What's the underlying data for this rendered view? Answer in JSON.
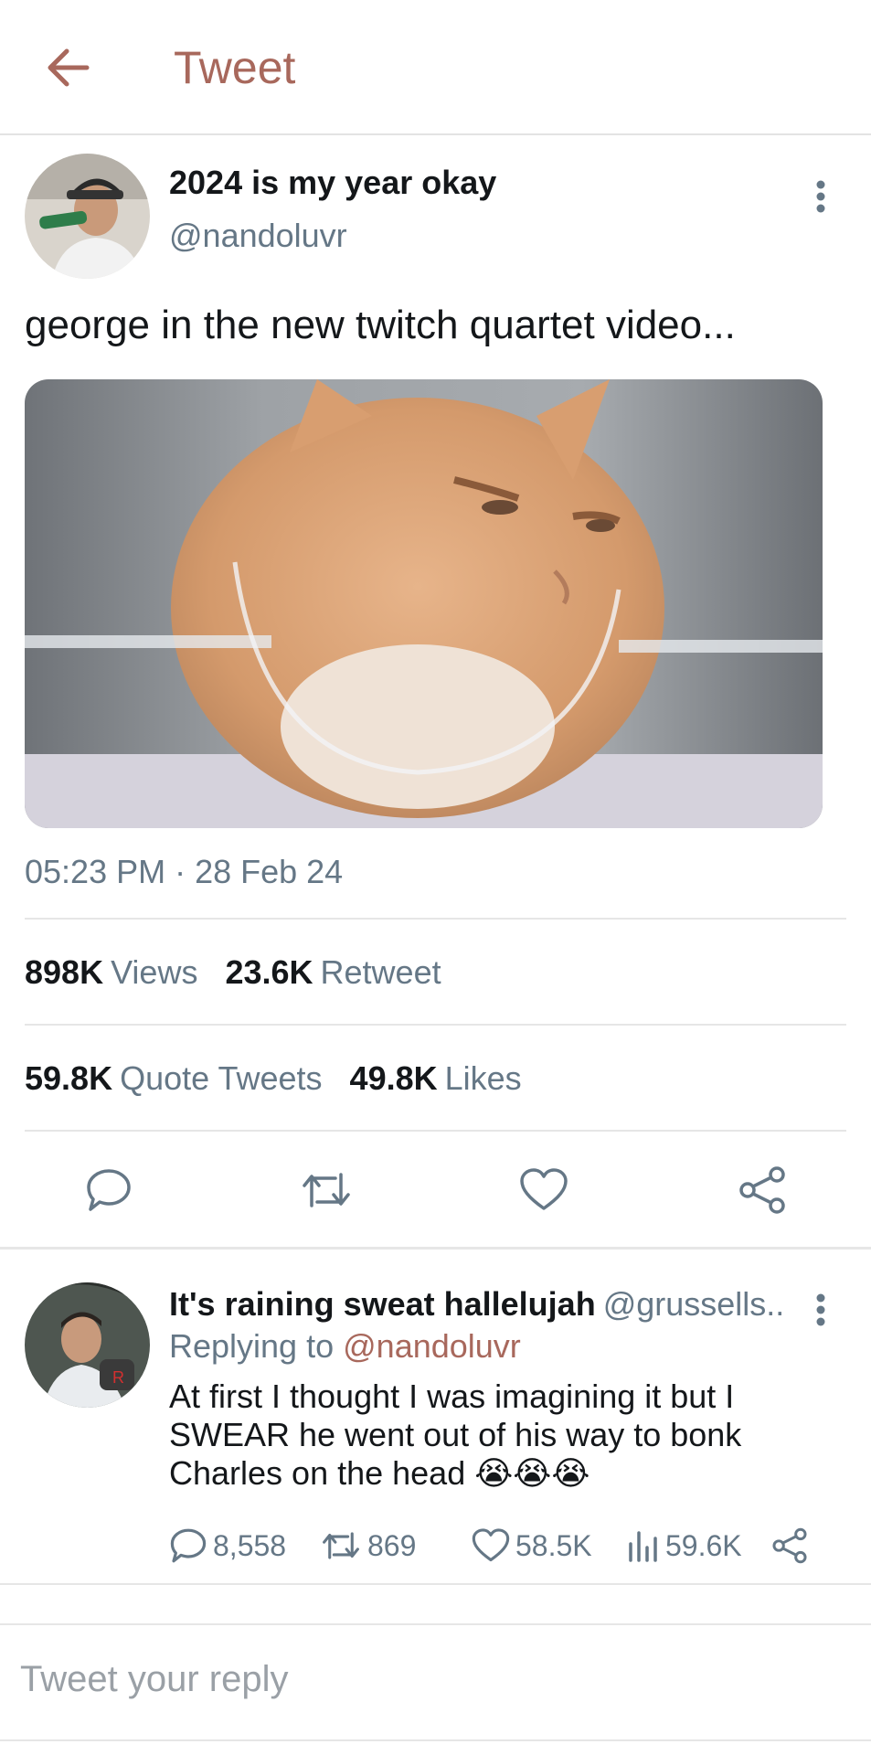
{
  "header": {
    "title": "Tweet",
    "back_icon": "arrow-left-icon"
  },
  "tweet": {
    "author_name": "2024 is my year okay",
    "author_handle": "@nandoluvr",
    "text": "george in the new twitch quartet video...",
    "timestamp": "05:23 PM · 28 Feb 24",
    "stats": {
      "views_count": "898K",
      "views_label": "Views",
      "retweet_count": "23.6K",
      "retweet_label": "Retweet",
      "quote_count": "59.8K",
      "quote_label": "Quote Tweets",
      "likes_count": "49.8K",
      "likes_label": "Likes"
    },
    "actions": [
      "reply-icon",
      "retweet-icon",
      "heart-icon",
      "share-icon"
    ]
  },
  "reply": {
    "author_name": "It's raining sweat hallelujah",
    "author_handle": "@grussells...",
    "replying_label": "Replying to",
    "replying_handle": "@nandoluvr",
    "text": "At first I thought I was imagining it but I SWEAR he went out of his way to bonk Charles on the head 😭😭😭",
    "stats": {
      "replies": "8,558",
      "retweets": "869",
      "likes": "58.5K",
      "views": "59.6K"
    }
  },
  "compose": {
    "placeholder": "Tweet your reply"
  },
  "colors": {
    "accent": "#a8685c",
    "secondary_text": "#657786",
    "divider": "#e6e6e6"
  }
}
